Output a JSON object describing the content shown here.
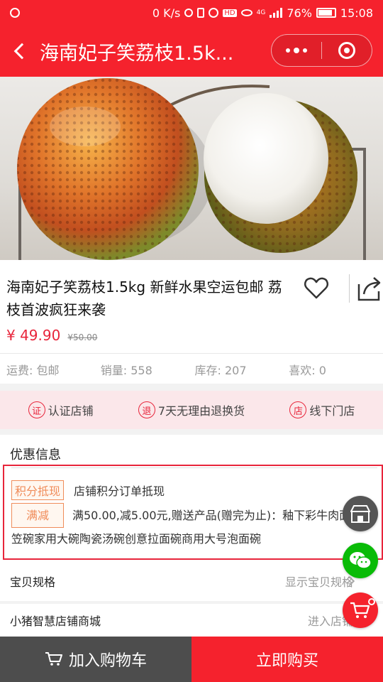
{
  "status_bar": {
    "network_speed": "0 K/s",
    "network_type": "4G",
    "battery": "76%",
    "time": "15:08"
  },
  "nav": {
    "title": "海南妃子笑荔枝1.5k..."
  },
  "product": {
    "title": "海南妃子笑荔枝1.5kg 新鲜水果空运包邮 荔枝首波疯狂来袭",
    "price": "¥ 49.90",
    "original_price": "¥50.00",
    "stats": {
      "shipping": "运费: 包邮",
      "sales": "销量: 558",
      "stock": "库存: 207",
      "likes": "喜欢: 0"
    }
  },
  "guarantees": [
    {
      "icon_char": "证",
      "label": "认证店铺"
    },
    {
      "icon_char": "退",
      "label": "7天无理由退换货"
    },
    {
      "icon_char": "店",
      "label": "线下门店"
    }
  ],
  "promo": {
    "title": "优惠信息",
    "items": [
      {
        "tag": "积分抵现",
        "text": "店铺积分订单抵现"
      },
      {
        "tag": "满减",
        "text": "满50.00,减5.00元,赠送产品(赠完为止)：釉下彩牛肉面碗斗笠碗家用大碗陶瓷汤碗创意拉面碗商用大号泡面碗"
      }
    ]
  },
  "rows": {
    "spec": {
      "label": "宝贝规格",
      "value": "显示宝贝规格"
    },
    "store": {
      "label": "小猪智慧店铺商城",
      "value": "进入店铺"
    }
  },
  "bottom": {
    "cart_label": "加入购物车",
    "buy_label": "立即购买"
  },
  "colors": {
    "brand_red": "#f5222d",
    "price_red": "#e8253b",
    "tag_orange": "#f08c5a",
    "wechat_green": "#09bb07"
  },
  "icons": {
    "favorite": "heart-icon",
    "share": "share-icon",
    "cart": "cart-icon",
    "shop": "shop-icon",
    "chat": "wechat-icon"
  }
}
